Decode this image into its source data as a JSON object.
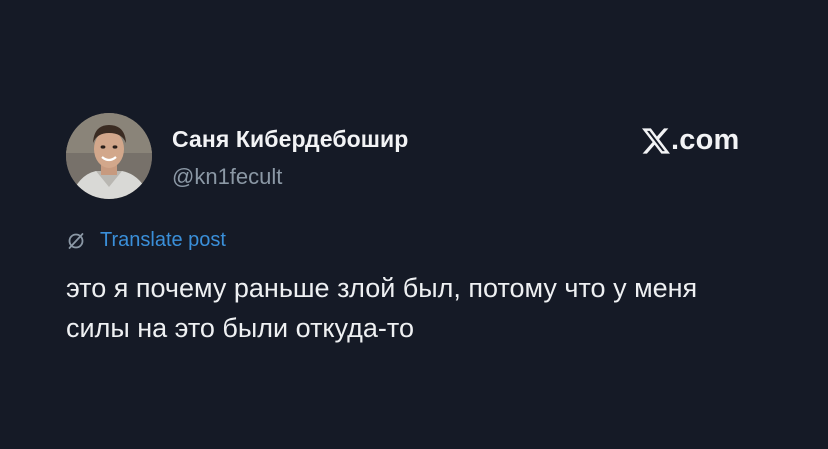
{
  "author": {
    "display_name": "Саня Кибердебошир",
    "handle": "@kn1fecult",
    "avatar_icon": "profile-photo"
  },
  "brand": {
    "text": ".com",
    "icon": "x-logo-icon"
  },
  "translate": {
    "label": "Translate post",
    "icon": "globe-slash-icon",
    "color": "#3a8fd9"
  },
  "post": {
    "text": "это я почему раньше злой был, потому что у меня силы на это были откуда-то"
  },
  "colors": {
    "background": "#151a26",
    "text": "#eef0f2",
    "muted": "#8b98a5"
  }
}
